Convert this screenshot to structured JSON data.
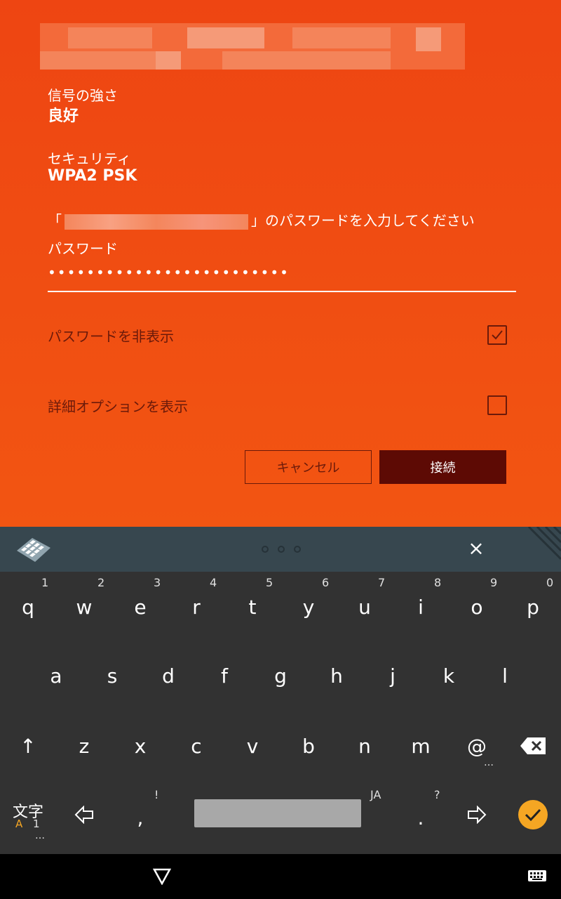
{
  "wifi": {
    "signal_label": "信号の強さ",
    "signal_value": "良好",
    "security_label": "セキュリティ",
    "security_value": "WPA2 PSK",
    "prompt_open": "「",
    "prompt_close": "」のパスワードを入力してください",
    "password_label": "パスワード",
    "password_value": "•••••••••••••••••••••••••",
    "hide_password_label": "パスワードを非表示",
    "hide_password_checked": true,
    "advanced_label": "詳細オプションを表示",
    "advanced_checked": false,
    "cancel_label": "キャンセル",
    "connect_label": "接続"
  },
  "keyboard": {
    "row1": [
      "q",
      "w",
      "e",
      "r",
      "t",
      "y",
      "u",
      "i",
      "o",
      "p"
    ],
    "row1_numbers": [
      "1",
      "2",
      "3",
      "4",
      "5",
      "6",
      "7",
      "8",
      "9",
      "0"
    ],
    "row2": [
      "a",
      "s",
      "d",
      "f",
      "g",
      "h",
      "j",
      "k",
      "l"
    ],
    "row3": [
      "z",
      "x",
      "c",
      "v",
      "b",
      "n",
      "m",
      "@"
    ],
    "shift": "↑",
    "more_dots": "…",
    "mode_label": "文字",
    "mode_sub_a": "A",
    "mode_sub_1": "1",
    "comma": ",",
    "comma_hint": "!",
    "lang_hint": "JA",
    "period": ".",
    "period_hint": "?",
    "close": "×"
  },
  "colors": {
    "accent": "#ee4512",
    "keyboard": "#323232",
    "enter": "#f5a623"
  }
}
